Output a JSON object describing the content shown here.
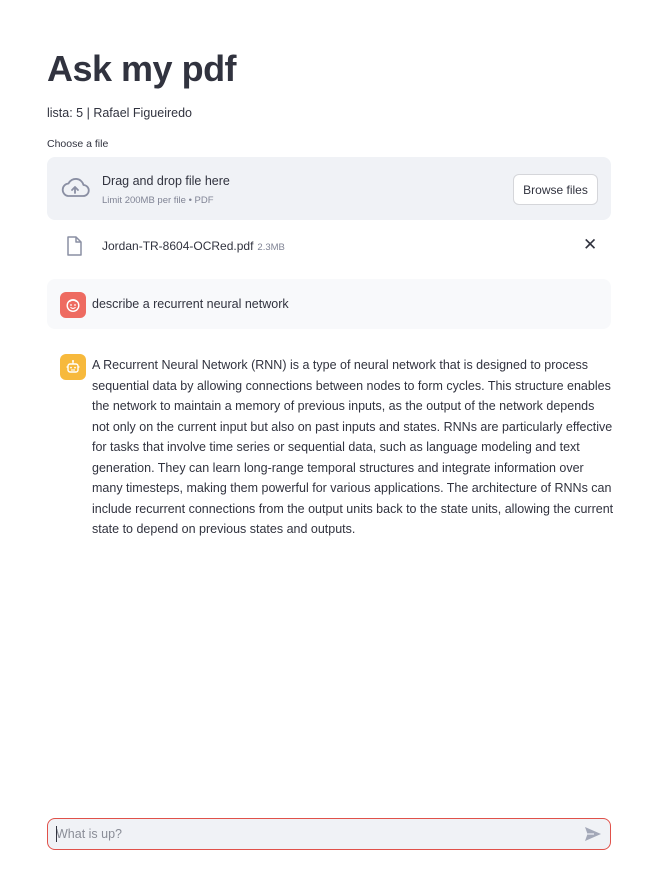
{
  "app": {
    "title": "Ask my pdf",
    "subtitle": "lista: 5 | Rafael Figueiredo"
  },
  "uploader": {
    "label": "Choose a file",
    "drop_title": "Drag and drop file here",
    "drop_hint": "Limit 200MB per file • PDF",
    "browse_label": "Browse files",
    "file": {
      "name": "Jordan-TR-8604-OCRed.pdf",
      "size": "2.3MB",
      "remove_symbol": "✕"
    }
  },
  "chat": {
    "messages": [
      {
        "role": "user",
        "avatar_icon": "user-face-icon",
        "text": "describe a recurrent neural network"
      },
      {
        "role": "assistant",
        "avatar_icon": "robot-icon",
        "text": "A Recurrent Neural Network (RNN) is a type of neural network that is designed to process sequential data by allowing connections between nodes to form cycles. This structure enables the network to maintain a memory of previous inputs, as the output of the network depends not only on the current input but also on past inputs and states. RNNs are particularly effective for tasks that involve time series or sequential data, such as language modeling and text generation. They can learn long-range temporal structures and integrate information over many timesteps, making them powerful for various applications. The architecture of RNNs can include recurrent connections from the output units back to the state units, allowing the current state to depend on previous states and outputs."
      }
    ],
    "input": {
      "placeholder": "What is up?",
      "value": ""
    }
  },
  "colors": {
    "user_avatar": "#ee6b61",
    "bot_avatar": "#f7b93c",
    "input_border": "#e0514a",
    "panel_bg": "#f0f2f6"
  }
}
